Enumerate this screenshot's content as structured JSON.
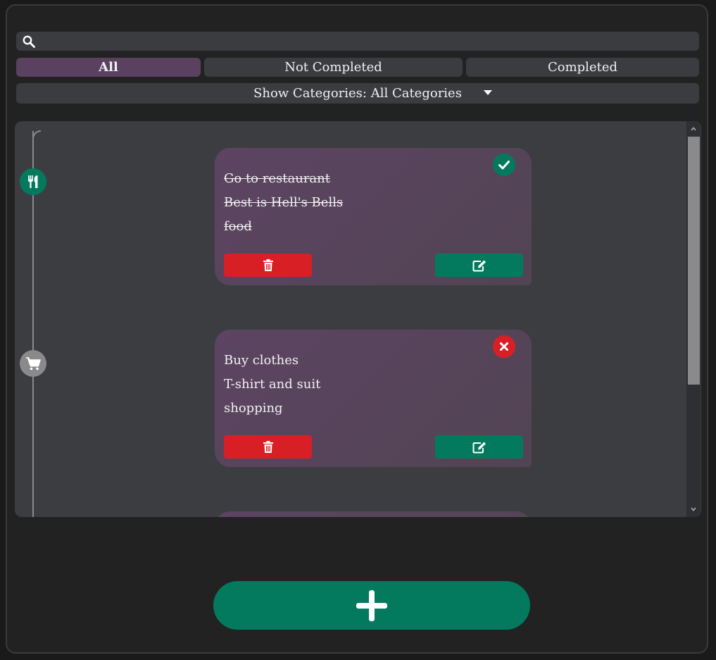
{
  "search": {
    "placeholder": "",
    "value": "",
    "icon": "search-icon"
  },
  "filters": {
    "tabs": [
      {
        "label": "All",
        "active": true
      },
      {
        "label": "Not Completed",
        "active": false
      },
      {
        "label": "Completed",
        "active": false
      }
    ]
  },
  "category_select": {
    "label": "Show Categories: All Categories"
  },
  "tasks": [
    {
      "title": "Go to restaurant",
      "description": "Best is Hell's Bells",
      "category": "food",
      "completed": true,
      "category_icon": "utensils-icon",
      "category_color": "#037a5e"
    },
    {
      "title": "Buy clothes",
      "description": "T-shirt and suit",
      "category": "shopping",
      "completed": false,
      "category_icon": "shopping-cart-icon",
      "category_color": "#8a8a8c"
    }
  ],
  "colors": {
    "accent_green": "#037a5e",
    "delete_red": "#d91f26",
    "active_tab": "#5a4160",
    "card": "#5c4462"
  },
  "add_button": {
    "icon": "plus-icon"
  }
}
